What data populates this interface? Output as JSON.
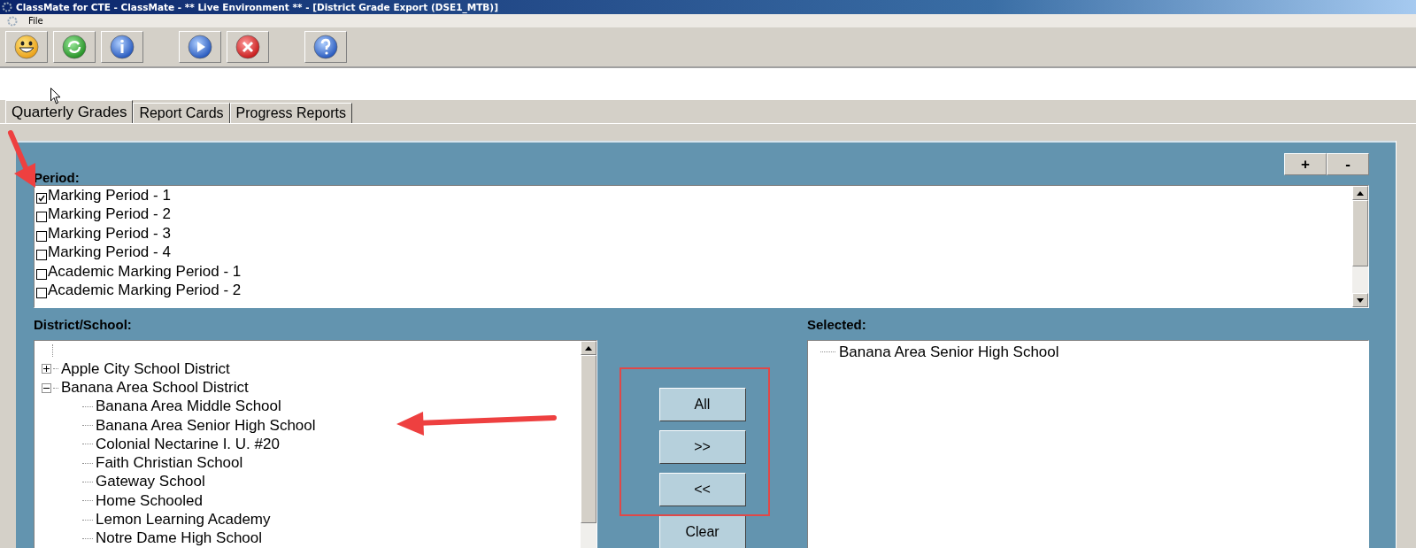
{
  "window": {
    "title": "ClassMate for CTE - ClassMate - ** Live Environment ** - [District Grade Export (DSE1_MTB)]"
  },
  "menu": [
    "File"
  ],
  "tabs": [
    {
      "label": "Quarterly Grades",
      "selected": true
    },
    {
      "label": "Report Cards",
      "selected": false
    },
    {
      "label": "Progress Reports",
      "selected": false
    }
  ],
  "period": {
    "label": "Period:",
    "zoom_buttons": [
      "+",
      "-"
    ],
    "items": [
      {
        "label": "Marking Period - 1",
        "checked": true
      },
      {
        "label": "Marking Period - 2",
        "checked": false
      },
      {
        "label": "Marking Period - 3",
        "checked": false
      },
      {
        "label": "Marking Period - 4",
        "checked": false
      },
      {
        "label": "Academic Marking Period - 1",
        "checked": false
      },
      {
        "label": "Academic Marking Period - 2",
        "checked": false
      }
    ]
  },
  "district": {
    "label": "District/School:",
    "tree": [
      {
        "label": "Apple City School District",
        "expanded": false
      },
      {
        "label": "Banana Area School District",
        "expanded": true,
        "children": [
          {
            "label": "Banana Area Middle School"
          },
          {
            "label": "Banana Area Senior High School"
          },
          {
            "label": "Colonial Nectarine I. U. #20"
          },
          {
            "label": "Faith Christian School"
          },
          {
            "label": "Gateway School"
          },
          {
            "label": "Home Schooled"
          },
          {
            "label": "Lemon Learning Academy"
          },
          {
            "label": "Notre Dame High School"
          }
        ]
      }
    ]
  },
  "transfer_buttons": [
    "All",
    ">>",
    "<<",
    "Clear"
  ],
  "selected": {
    "label": "Selected:",
    "items": [
      "Banana Area Senior High School"
    ]
  }
}
